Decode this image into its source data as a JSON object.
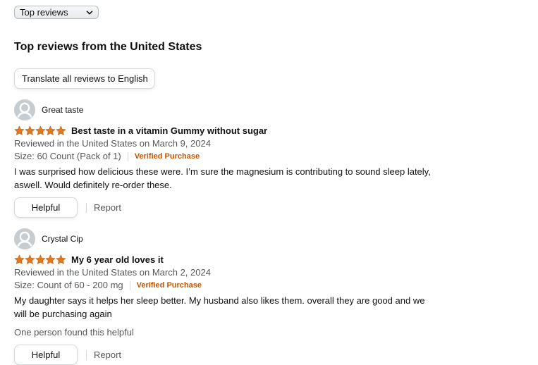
{
  "sort": {
    "selected": "Top reviews",
    "icon": "chevron-down-icon"
  },
  "section_title": "Top reviews from the United States",
  "translate_button": "Translate all reviews to English",
  "colors": {
    "star": "#de7921",
    "verified": "#c45500",
    "muted_text": "#565959",
    "avatar_bg": "#c7ccd1"
  },
  "reviews": [
    {
      "reviewer": "Great taste",
      "rating": 5,
      "rating_max": 5,
      "title": "Best taste in a vitamin Gummy without sugar",
      "date": "Reviewed in the United States on March 9, 2024",
      "variant": "Size: 60 Count (Pack of 1)",
      "verified": "Verified Purchase",
      "body": "I was surprised how delicious these were. I’m sure the magnesium is contributing to sound sleep lately, aswell. Would definitely re-order these.",
      "helpful_count": "",
      "helpful_label": "Helpful",
      "report_label": "Report"
    },
    {
      "reviewer": "Crystal Cip",
      "rating": 5,
      "rating_max": 5,
      "title": "My 6 year old loves it",
      "date": "Reviewed in the United States on March 2, 2024",
      "variant": "Size: Count of 60 - 200 mg",
      "verified": "Verified Purchase",
      "body": "My daughter says it helps her sleep better. My husband also likes them. overall they are good and we will be purchasing again",
      "helpful_count": "One person found this helpful",
      "helpful_label": "Helpful",
      "report_label": "Report"
    }
  ]
}
